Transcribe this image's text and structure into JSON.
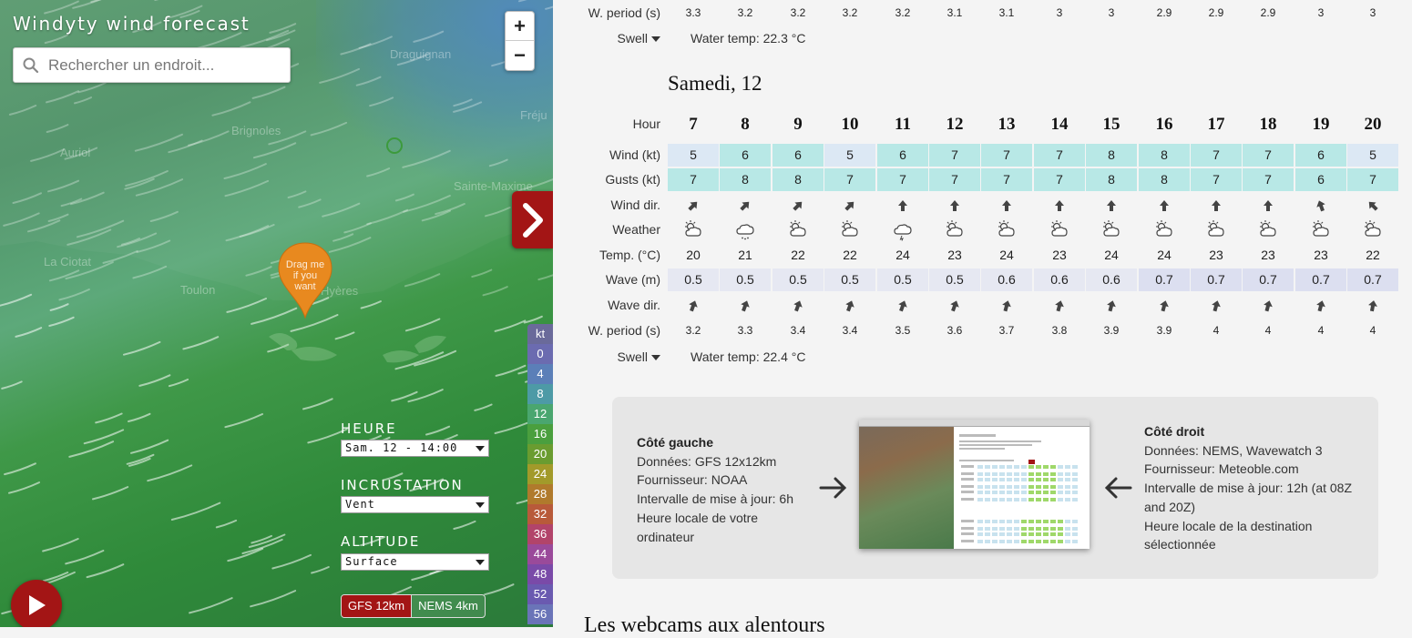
{
  "app": {
    "title": "Windyty wind forecast",
    "search_placeholder": "Rechercher un endroit...",
    "zoom_in": "+",
    "zoom_out": "−",
    "pin_text": [
      "Drag me",
      "if you",
      "want"
    ],
    "cities": [
      "Draguignan",
      "Brignoles",
      "Auriol",
      "Fréju",
      "Sainte-Maxime",
      "La Ciotat",
      "Toulon",
      "Hyères"
    ],
    "legend_unit": "kt",
    "legend_values": [
      "0",
      "4",
      "8",
      "12",
      "16",
      "20",
      "24",
      "28",
      "32",
      "36",
      "44",
      "48",
      "52",
      "56"
    ],
    "legend_colors": [
      "#6b6bb0",
      "#5b7fb8",
      "#4d9aa6",
      "#4aa66f",
      "#4a9f3e",
      "#6a9c30",
      "#a29a2a",
      "#b07a2c",
      "#b85a3a",
      "#b2446a",
      "#9a4a9a",
      "#7a4aa8",
      "#6a5ab0",
      "#6a74b8"
    ],
    "heure_label": "HEURE",
    "heure_value": "Sam. 12 - 14:00",
    "incrustation_label": "INCRUSTATION",
    "incrustation_value": "Vent",
    "altitude_label": "ALTITUDE",
    "altitude_value": "Surface",
    "model_active": "GFS 12km",
    "model_inactive": "NEMS 4km"
  },
  "prev_day": {
    "period_label": "W. period (s)",
    "periods": [
      "3.3",
      "3.2",
      "3.2",
      "3.2",
      "3.2",
      "3.1",
      "3.1",
      "3",
      "3",
      "2.9",
      "2.9",
      "2.9",
      "3",
      "3"
    ],
    "swell_label": "Swell",
    "water_temp": "Water temp: 22.3 °C"
  },
  "day": {
    "title": "Samedi, 12",
    "labels": {
      "hour": "Hour",
      "wind": "Wind (kt)",
      "gusts": "Gusts (kt)",
      "wind_dir": "Wind dir.",
      "weather": "Weather",
      "temp": "Temp. (°C)",
      "wave": "Wave (m)",
      "wave_dir": "Wave dir.",
      "period": "W. period (s)"
    },
    "hours": [
      "7",
      "8",
      "9",
      "10",
      "11",
      "12",
      "13",
      "14",
      "15",
      "16",
      "17",
      "18",
      "19",
      "20"
    ],
    "wind": [
      "5",
      "6",
      "6",
      "5",
      "6",
      "7",
      "7",
      "7",
      "8",
      "8",
      "7",
      "7",
      "6",
      "5"
    ],
    "gusts": [
      "7",
      "8",
      "8",
      "7",
      "7",
      "7",
      "7",
      "7",
      "8",
      "8",
      "7",
      "7",
      "6",
      "7"
    ],
    "wind_dir_deg": [
      45,
      45,
      45,
      45,
      0,
      0,
      0,
      0,
      0,
      0,
      0,
      0,
      -20,
      -45
    ],
    "weather_icons": [
      "partly-cloudy-icon",
      "rain-cloud-icon",
      "partly-cloudy-icon",
      "partly-cloudy-icon",
      "thunder-cloud-icon",
      "partly-cloudy-icon",
      "partly-cloudy-icon",
      "partly-cloudy-icon",
      "partly-cloudy-icon",
      "partly-cloudy-icon",
      "partly-cloudy-icon",
      "partly-cloudy-icon",
      "partly-cloudy-icon",
      "partly-cloudy-icon"
    ],
    "temp": [
      "20",
      "21",
      "22",
      "22",
      "24",
      "23",
      "24",
      "23",
      "24",
      "24",
      "23",
      "23",
      "23",
      "22"
    ],
    "wave": [
      "0.5",
      "0.5",
      "0.5",
      "0.5",
      "0.5",
      "0.5",
      "0.6",
      "0.6",
      "0.6",
      "0.7",
      "0.7",
      "0.7",
      "0.7",
      "0.7"
    ],
    "wave_dir_deg": [
      20,
      20,
      20,
      20,
      20,
      20,
      15,
      15,
      15,
      15,
      15,
      15,
      15,
      10
    ],
    "periods": [
      "3.2",
      "3.3",
      "3.4",
      "3.4",
      "3.5",
      "3.6",
      "3.7",
      "3.8",
      "3.9",
      "3.9",
      "4",
      "4",
      "4",
      "4"
    ],
    "swell_label": "Swell",
    "water_temp": "Water temp: 22.4 °C"
  },
  "colors": {
    "wind_low": "#dce8f4",
    "wind_high": "#b8e8e6",
    "wave_low": "#e6e8f2",
    "wave_high": "#dcdff0",
    "brand_red": "#a31515"
  },
  "info": {
    "left_title": "Côté gauche",
    "left_lines": [
      "Données: GFS 12x12km",
      "Fournisseur: NOAA",
      "Intervalle de mise à jour: 6h",
      "Heure locale de votre ordinateur"
    ],
    "right_title": "Côté droit",
    "right_lines": [
      "Données: NEMS, Wavewatch 3",
      "Fournisseur: Meteoble.com",
      "Intervalle de mise à jour: 12h (at 08Z and 20Z)",
      "Heure locale de la destination sélectionnée"
    ]
  },
  "webcams_title": "Les webcams aux alentours"
}
